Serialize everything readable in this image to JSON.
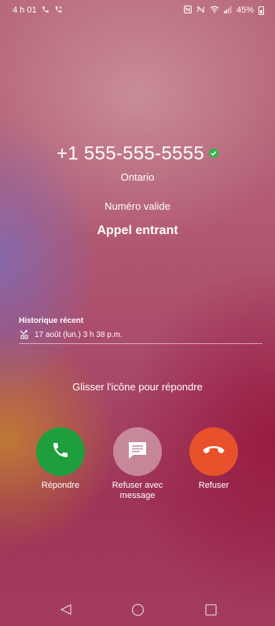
{
  "status_bar": {
    "time": "4 h 01",
    "battery": "45%"
  },
  "caller": {
    "number": "+1 555-555-5555",
    "location": "Ontario",
    "validation": "Numéro valide",
    "call_status": "Appel entrant"
  },
  "history": {
    "title": "Historique récent",
    "entry": "17 août (lun.) 3 h 38 p.m."
  },
  "hint": "Glisser l'icône pour répondre",
  "actions": {
    "answer_label": "Répondre",
    "message_label": "Refuser avec message",
    "decline_label": "Refuser"
  },
  "colors": {
    "answer": "#1f9e3e",
    "decline": "#e8512b",
    "verified": "#2fb34a"
  }
}
